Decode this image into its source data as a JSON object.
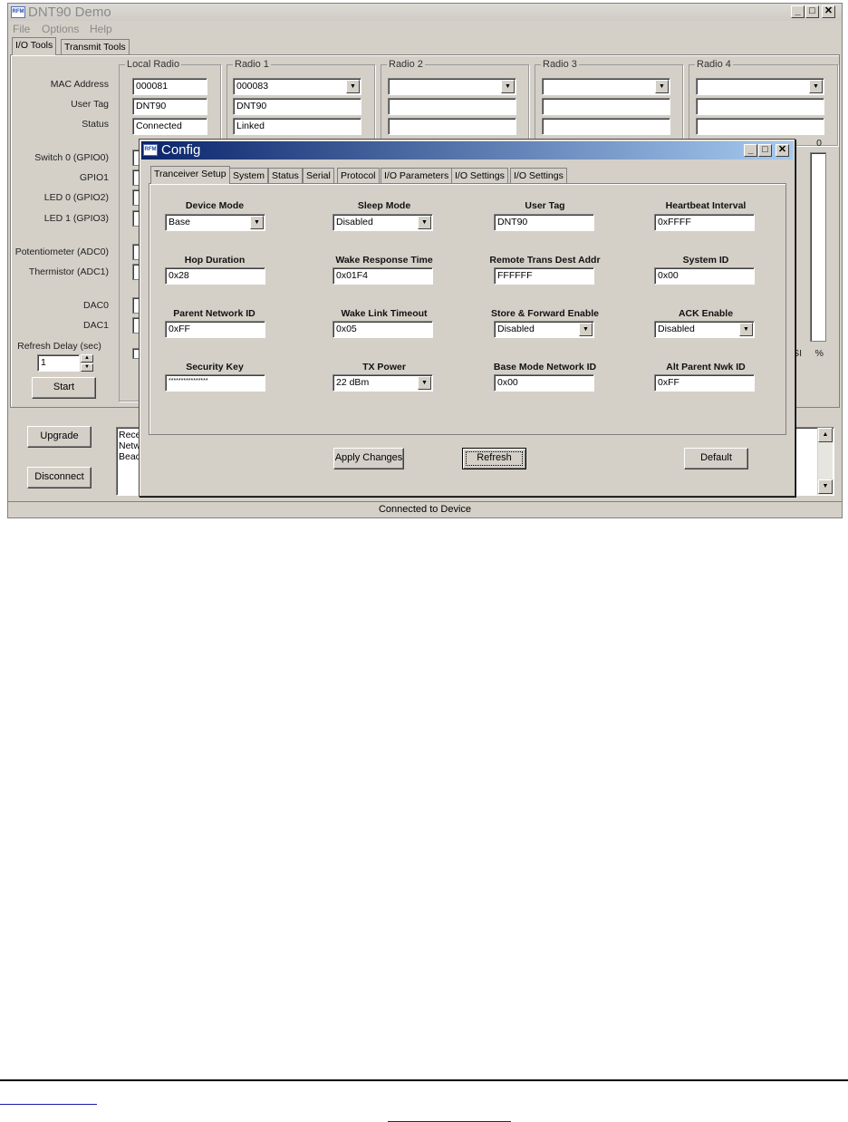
{
  "window": {
    "title": "DNT90 Demo",
    "icon_text": "RFM",
    "menu": [
      "File",
      "Options",
      "Help"
    ],
    "min": "_",
    "max": "□",
    "close": "✕"
  },
  "tabs": [
    "I/O Tools",
    "Transmit Tools"
  ],
  "radios": {
    "headers": [
      "Local Radio",
      "Radio 1",
      "Radio 2",
      "Radio 3",
      "Radio 4"
    ],
    "row_labels": [
      "MAC Address",
      "User Tag",
      "Status"
    ],
    "local": {
      "mac": "000081",
      "tag": "DNT90",
      "status": "Connected"
    },
    "radio1": {
      "mac": "000083",
      "tag": "DNT90",
      "status": "Linked"
    }
  },
  "io_labels": [
    "Switch 0 (GPIO0)",
    "GPIO1",
    "LED 0 (GPIO2)",
    "LED 1 (GPIO3)",
    "Potentiometer (ADC0)",
    "Thermistor (ADC1)",
    "DAC0",
    "DAC1"
  ],
  "refresh": {
    "label": "Refresh Delay (sec)",
    "value": "1"
  },
  "start_button": "Start",
  "meter": {
    "value": "0",
    "label_left": "SI",
    "label_right": "%"
  },
  "upgrade_button": "Upgrade",
  "disconnect_button": "Disconnect",
  "log_lines": [
    "Rece",
    "Netw",
    "Beac"
  ],
  "status_bar": "Connected to Device",
  "config": {
    "title": "Config",
    "tabs": [
      "Tranceiver Setup",
      "System",
      "Status",
      "Serial",
      "Protocol",
      "I/O Parameters",
      "I/O Settings",
      "I/O Settings"
    ],
    "fields": [
      {
        "label": "Device Mode",
        "value": "Base",
        "combo": true
      },
      {
        "label": "Sleep Mode",
        "value": "Disabled",
        "combo": true
      },
      {
        "label": "User Tag",
        "value": "DNT90",
        "combo": false
      },
      {
        "label": "Heartbeat Interval",
        "value": "0xFFFF",
        "combo": false
      },
      {
        "label": "Hop Duration",
        "value": "0x28",
        "combo": false
      },
      {
        "label": "Wake Response Time",
        "value": "0x01F4",
        "combo": false
      },
      {
        "label": "Remote Trans Dest Addr",
        "value": "FFFFFF",
        "combo": false
      },
      {
        "label": "System ID",
        "value": "0x00",
        "combo": false
      },
      {
        "label": "Parent Network ID",
        "value": "0xFF",
        "combo": false
      },
      {
        "label": "Wake Link Timeout",
        "value": "0x05",
        "combo": false
      },
      {
        "label": "Store & Forward Enable",
        "value": "Disabled",
        "combo": true
      },
      {
        "label": "ACK Enable",
        "value": "Disabled",
        "combo": true
      },
      {
        "label": "Security Key",
        "value": "****************",
        "combo": false
      },
      {
        "label": "TX Power",
        "value": "22 dBm",
        "combo": true
      },
      {
        "label": "Base Mode Network ID",
        "value": "0x00",
        "combo": false
      },
      {
        "label": "Alt Parent Nwk ID",
        "value": "0xFF",
        "combo": false
      }
    ],
    "apply_button": "Apply Changes",
    "refresh_button": "Refresh",
    "default_button": "Default"
  }
}
